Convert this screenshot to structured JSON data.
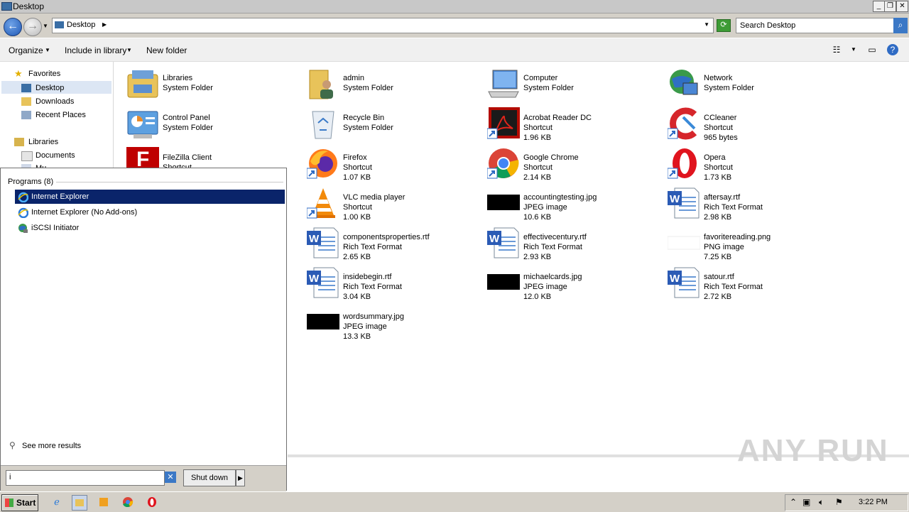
{
  "window": {
    "title": "Desktop"
  },
  "address": {
    "path": "Desktop",
    "search_placeholder": "Search Desktop"
  },
  "toolbar": {
    "organize": "Organize",
    "include_in_library": "Include in library",
    "new_folder": "New folder"
  },
  "navpane": {
    "favorites": "Favorites",
    "items": [
      "Desktop",
      "Downloads",
      "Recent Places"
    ],
    "libraries": "Libraries",
    "library_items": [
      "Documents",
      "Mu"
    ]
  },
  "files": [
    {
      "name": "Libraries",
      "type": "System Folder",
      "size": "",
      "icon": "libraries-icon"
    },
    {
      "name": "admin",
      "type": "System Folder",
      "size": "",
      "icon": "user-folder-icon"
    },
    {
      "name": "Computer",
      "type": "System Folder",
      "size": "",
      "icon": "computer-icon"
    },
    {
      "name": "Network",
      "type": "System Folder",
      "size": "",
      "icon": "network-icon"
    },
    {
      "name": "Control Panel",
      "type": "System Folder",
      "size": "",
      "icon": "control-panel-icon"
    },
    {
      "name": "Recycle Bin",
      "type": "System Folder",
      "size": "",
      "icon": "recycle-bin-icon"
    },
    {
      "name": "Acrobat Reader DC",
      "type": "Shortcut",
      "size": "1.96 KB",
      "icon": "acrobat-icon"
    },
    {
      "name": "CCleaner",
      "type": "Shortcut",
      "size": "965 bytes",
      "icon": "ccleaner-icon"
    },
    {
      "name": "FileZilla Client",
      "type": "Shortcut",
      "size": "",
      "icon": "filezilla-icon"
    },
    {
      "name": "Firefox",
      "type": "Shortcut",
      "size": "1.07 KB",
      "icon": "firefox-icon"
    },
    {
      "name": "Google Chrome",
      "type": "Shortcut",
      "size": "2.14 KB",
      "icon": "chrome-icon"
    },
    {
      "name": "Opera",
      "type": "Shortcut",
      "size": "1.73 KB",
      "icon": "opera-icon"
    },
    {
      "name": "VLC media player",
      "type": "Shortcut",
      "size": "1.00 KB",
      "icon": "vlc-icon"
    },
    {
      "name": "accountingtesting.jpg",
      "type": "JPEG image",
      "size": "10.6 KB",
      "icon": "jpeg-thumbnail-icon"
    },
    {
      "name": "aftersay.rtf",
      "type": "Rich Text Format",
      "size": "2.98 KB",
      "icon": "rtf-icon"
    },
    {
      "name": "componentsproperties.rtf",
      "type": "Rich Text Format",
      "size": "2.65 KB",
      "icon": "rtf-icon"
    },
    {
      "name": "effectivecentury.rtf",
      "type": "Rich Text Format",
      "size": "2.93 KB",
      "icon": "rtf-icon"
    },
    {
      "name": "favoritereading.png",
      "type": "PNG image",
      "size": "7.25 KB",
      "icon": "png-thumbnail-icon"
    },
    {
      "name": "insidebegin.rtf",
      "type": "Rich Text Format",
      "size": "3.04 KB",
      "icon": "rtf-icon"
    },
    {
      "name": "michaelcards.jpg",
      "type": "JPEG image",
      "size": "12.0 KB",
      "icon": "jpeg-thumbnail-icon"
    },
    {
      "name": "satour.rtf",
      "type": "Rich Text Format",
      "size": "2.72 KB",
      "icon": "rtf-icon"
    },
    {
      "name": "wordsummary.jpg",
      "type": "JPEG image",
      "size": "13.3 KB",
      "icon": "jpeg-thumbnail-icon"
    }
  ],
  "startmenu": {
    "header": "Programs (8)",
    "programs": [
      "Internet Explorer",
      "Internet Explorer (No Add-ons)",
      "iSCSI Initiator"
    ],
    "see_more": "See more results",
    "search_value": "i",
    "shutdown": "Shut down"
  },
  "taskbar": {
    "start": "Start",
    "clock": "3:22 PM"
  },
  "watermark": "ANY RUN",
  "colors": {
    "selection": "#0a246a",
    "chrome": "#d4d0c8"
  }
}
